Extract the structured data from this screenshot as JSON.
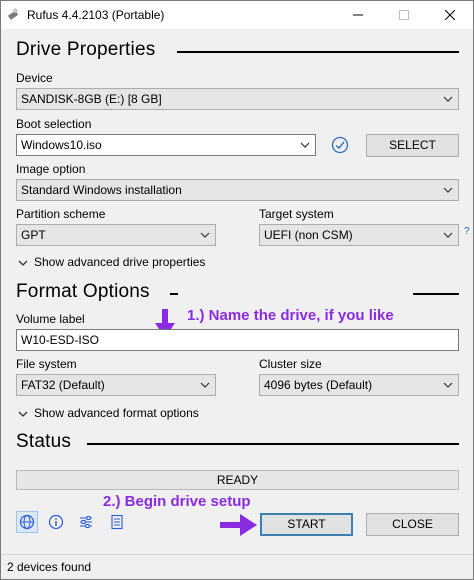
{
  "window": {
    "title": "Rufus 4.4.2103 (Portable)"
  },
  "drive_properties": {
    "heading": "Drive Properties",
    "device_label": "Device",
    "device_value": "SANDISK-8GB (E:) [8 GB]",
    "boot_label": "Boot selection",
    "boot_value": "Windows10.iso",
    "select_button": "SELECT",
    "image_option_label": "Image option",
    "image_option_value": "Standard Windows installation",
    "partition_label": "Partition scheme",
    "partition_value": "GPT",
    "target_label": "Target system",
    "target_value": "UEFI (non CSM)",
    "help_mark": "?",
    "advanced_toggle": "Show advanced drive properties"
  },
  "format_options": {
    "heading": "Format Options",
    "volume_label": "Volume label",
    "volume_value": "W10-ESD-ISO",
    "fs_label": "File system",
    "fs_value": "FAT32 (Default)",
    "cluster_label": "Cluster size",
    "cluster_value": "4096 bytes (Default)",
    "advanced_toggle": "Show advanced format options"
  },
  "status": {
    "heading": "Status",
    "progress_text": "READY"
  },
  "annotations": {
    "name_drive": "1.) Name the drive, if you like",
    "begin_setup": "2.) Begin drive setup",
    "arrow_color": "#8a2be2"
  },
  "actions": {
    "start": "START",
    "close": "CLOSE"
  },
  "toolbar_icons": [
    "globe-icon",
    "info-icon",
    "settings-sliders-icon",
    "log-icon"
  ],
  "footer": {
    "status_text": "2 devices found"
  }
}
